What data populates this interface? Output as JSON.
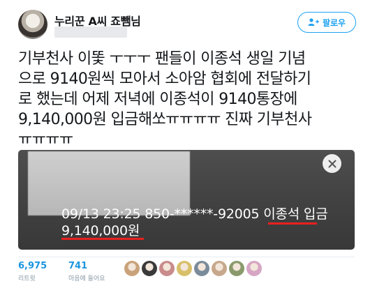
{
  "author": {
    "display_name": "누리꾼 A씨 죠뺌님",
    "avatar": "user-avatar"
  },
  "follow_button": {
    "label": "팔로우",
    "icon": "add-user-icon",
    "color": "#1da1f2"
  },
  "tweet": {
    "text": "기부천사 이똧 ㅜㅜㅜ 팬들이 이종석 생일 기념\n으로 9140원씩 모아서 소아암 협회에 전달하기\n로 했는데 어제 저녁에 이종석이 9140통장에\n9,140,000원 입금해쏘ㅠㅠㅠㅠ 진짜 기부천사\nㅠㅠㅠㅠ"
  },
  "media": {
    "line1": "09/13 23:25 850-******-92005 ",
    "line1_name": "이종석",
    "line1_suffix": " 입금",
    "line2": "9,140,000원",
    "close_icon": "close-icon",
    "highlight_color": "#e8201f"
  },
  "stats": {
    "retweets": {
      "count": "6,975",
      "label": "리트윗"
    },
    "likes": {
      "count": "741",
      "label": "마음에 들어요"
    }
  },
  "likers": [
    {
      "color": "#c9a27a"
    },
    {
      "color": "#3a3a3a"
    },
    {
      "color": "#c98b8b"
    },
    {
      "color": "#d8c06a"
    },
    {
      "color": "#7a8b9a"
    },
    {
      "color": "#c7a88c"
    },
    {
      "color": "#8a9a6c"
    },
    {
      "color": "#d7a6c4"
    }
  ]
}
